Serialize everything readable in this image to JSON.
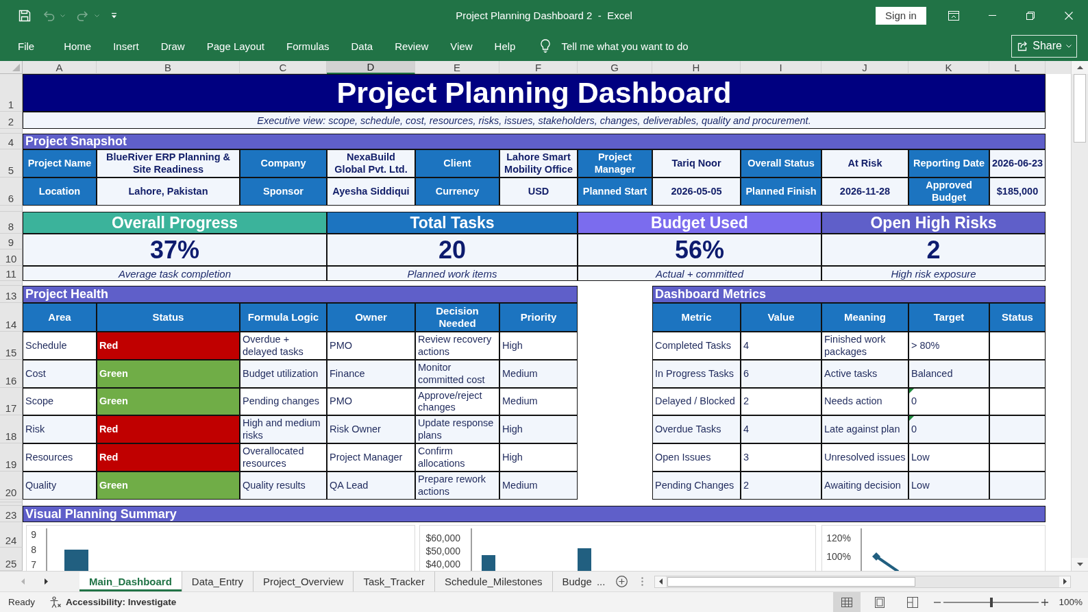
{
  "window": {
    "quick_access": [
      {
        "kind": "save",
        "disabled": false
      },
      {
        "kind": "undo",
        "disabled": true
      },
      {
        "kind": "redo",
        "disabled": true
      },
      {
        "kind": "customize",
        "disabled": false
      }
    ],
    "title": "Project Planning Dashboard 2  -  Excel",
    "sign_in": "Sign in"
  },
  "ribbon": {
    "tabs": [
      {
        "label": "File",
        "selected": false
      },
      {
        "label": "Home",
        "selected": false
      },
      {
        "label": "Insert",
        "selected": false
      },
      {
        "label": "Draw",
        "selected": false
      },
      {
        "label": "Page Layout",
        "selected": false
      },
      {
        "label": "Formulas",
        "selected": false
      },
      {
        "label": "Data",
        "selected": false
      },
      {
        "label": "Review",
        "selected": false
      },
      {
        "label": "View",
        "selected": false
      },
      {
        "label": "Help",
        "selected": false
      }
    ],
    "tell_me": {
      "placeholder": "Tell me what you want to do"
    },
    "share": "Share"
  },
  "columns": [
    {
      "label": "A",
      "selected": false
    },
    {
      "label": "B",
      "selected": false
    },
    {
      "label": "C",
      "selected": false
    },
    {
      "label": "D",
      "selected": true
    },
    {
      "label": "E",
      "selected": false
    },
    {
      "label": "F",
      "selected": false
    },
    {
      "label": "G",
      "selected": false
    },
    {
      "label": "H",
      "selected": false
    },
    {
      "label": "I",
      "selected": false
    },
    {
      "label": "J",
      "selected": false
    },
    {
      "label": "K",
      "selected": false
    },
    {
      "label": "L",
      "selected": false
    }
  ],
  "row_numbers": [
    "1",
    "2",
    "4",
    "5",
    "6",
    "8",
    "9",
    "10",
    "11",
    "13",
    "14",
    "15",
    "16",
    "17",
    "18",
    "19",
    "20",
    "23",
    "24",
    "25"
  ],
  "sheet": {
    "title": "Project Planning Dashboard",
    "subtitle": "Executive view: scope, schedule, cost, resources, risks, issues, stakeholders, changes, deliverables, quality and procurement.",
    "snapshot": {
      "heading": "Project Snapshot",
      "rows": [
        [
          {
            "label": "Project Name",
            "value": "BlueRiver ERP Planning & Site Readiness"
          },
          {
            "label": "Company",
            "value": "NexaBuild Global Pvt. Ltd."
          },
          {
            "label": "Client",
            "value": "Lahore Smart Mobility Office"
          },
          {
            "label": "Project Manager",
            "value": "Tariq Noor"
          },
          {
            "label": "Overall Status",
            "value": "At Risk"
          },
          {
            "label": "Reporting Date",
            "value": "2026-06-23"
          }
        ],
        [
          {
            "label": "Location",
            "value": "Lahore, Pakistan"
          },
          {
            "label": "Sponsor",
            "value": "Ayesha Siddiqui"
          },
          {
            "label": "Currency",
            "value": "USD"
          },
          {
            "label": "Planned Start",
            "value": "2026-05-05"
          },
          {
            "label": "Planned Finish",
            "value": "2026-11-28"
          },
          {
            "label": "Approved Budget",
            "value": "$185,000"
          }
        ]
      ]
    },
    "kpis": [
      {
        "title": "Overall Progress",
        "color": "#3bb39b",
        "value": "37%",
        "caption": "Average task completion"
      },
      {
        "title": "Total Tasks",
        "color": "#1c74c0",
        "value": "20",
        "caption": "Planned work items"
      },
      {
        "title": "Budget Used",
        "color": "#7b6cee",
        "value": "56%",
        "caption": "Actual + committed"
      },
      {
        "title": "Open High Risks",
        "color": "#5f5fc9",
        "value": "2",
        "caption": "High risk exposure"
      }
    ],
    "project_health": {
      "heading": "Project Health",
      "columns": [
        "Area",
        "Status",
        "Formula Logic",
        "Owner",
        "Decision Needed",
        "Priority"
      ],
      "rows": [
        {
          "area": "Schedule",
          "status": "Red",
          "color": "#c00000",
          "formula_logic": "Overdue + delayed tasks",
          "owner": "PMO",
          "decision_needed": "Review recovery actions",
          "priority": "High"
        },
        {
          "area": "Cost",
          "status": "Green",
          "color": "#70ad47",
          "formula_logic": "Budget utilization",
          "owner": "Finance",
          "decision_needed": "Monitor committed cost",
          "priority": "Medium"
        },
        {
          "area": "Scope",
          "status": "Green",
          "color": "#70ad47",
          "formula_logic": "Pending changes",
          "owner": "PMO",
          "decision_needed": "Approve/reject changes",
          "priority": "Medium"
        },
        {
          "area": "Risk",
          "status": "Red",
          "color": "#c00000",
          "formula_logic": "High and medium risks",
          "owner": "Risk Owner",
          "decision_needed": "Update response plans",
          "priority": "High"
        },
        {
          "area": "Resources",
          "status": "Red",
          "color": "#c00000",
          "formula_logic": "Overallocated resources",
          "owner": "Project Manager",
          "decision_needed": "Confirm allocations",
          "priority": "High"
        },
        {
          "area": "Quality",
          "status": "Green",
          "color": "#70ad47",
          "formula_logic": "Quality results",
          "owner": "QA Lead",
          "decision_needed": "Prepare rework actions",
          "priority": "Medium"
        }
      ]
    },
    "dashboard_metrics": {
      "heading": "Dashboard Metrics",
      "columns": [
        "Metric",
        "Value",
        "Meaning",
        "Target",
        "Status"
      ],
      "rows": [
        {
          "metric": "Completed Tasks",
          "value": "4",
          "meaning": "Finished work packages",
          "target": "> 80%",
          "target_error_flag": false
        },
        {
          "metric": "In Progress Tasks",
          "value": "6",
          "meaning": "Active tasks",
          "target": "Balanced",
          "target_error_flag": false
        },
        {
          "metric": "Delayed / Blocked",
          "value": "2",
          "meaning": "Needs action",
          "target": "0",
          "target_error_flag": true
        },
        {
          "metric": "Overdue Tasks",
          "value": "4",
          "meaning": "Late against plan",
          "target": "0",
          "target_error_flag": true
        },
        {
          "metric": "Open Issues",
          "value": "3",
          "meaning": "Unresolved issues",
          "target": "Low",
          "target_error_flag": false
        },
        {
          "metric": "Pending Changes",
          "value": "2",
          "meaning": "Awaiting decision",
          "target": "Low",
          "target_error_flag": false
        }
      ]
    },
    "visual_summary": {
      "heading": "Visual Planning Summary",
      "charts": [
        {
          "kind": "bar",
          "tick_labels": [
            "9",
            "8",
            "7"
          ]
        },
        {
          "kind": "bar",
          "tick_labels": [
            "$60,000",
            "$50,000",
            "$40,000"
          ]
        },
        {
          "kind": "line",
          "tick_labels": [
            "120%",
            "100%"
          ]
        }
      ]
    }
  },
  "sheet_tabs": {
    "nav_buttons": [
      {
        "kind": "previous",
        "disabled": true
      },
      {
        "kind": "next",
        "disabled": false
      }
    ],
    "tabs": [
      {
        "label": "Main_Dashboard",
        "selected": true
      },
      {
        "label": "Data_Entry",
        "selected": false
      },
      {
        "label": "Project_Overview",
        "selected": false
      },
      {
        "label": "Task_Tracker",
        "selected": false
      },
      {
        "label": "Schedule_Milestones",
        "selected": false
      },
      {
        "label": "Budge",
        "selected": false
      }
    ],
    "overflow": "..."
  },
  "status_bar": {
    "mode": "Ready",
    "accessibility": "Accessibility: Investigate",
    "views": [
      {
        "kind": "normal",
        "selected": true
      },
      {
        "kind": "page_layout",
        "selected": false
      },
      {
        "kind": "page_break_preview",
        "selected": false
      }
    ],
    "zoom": {
      "level": 0.5,
      "reading": "100%"
    }
  }
}
